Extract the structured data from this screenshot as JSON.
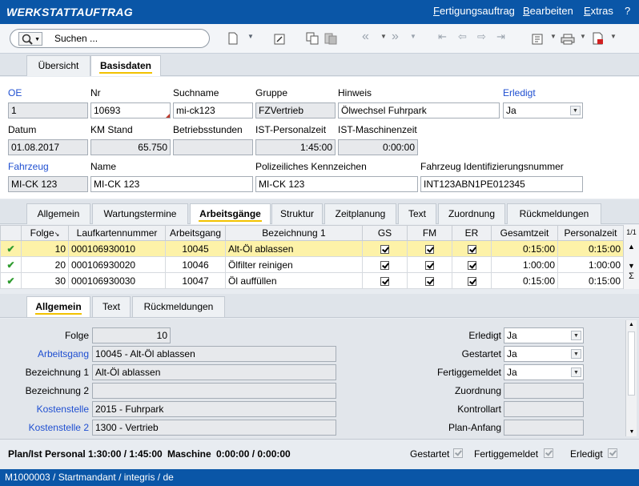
{
  "app": {
    "title": "WERKSTATTAUFTRAG"
  },
  "menu": [
    {
      "label": "Fertigungsauftrag"
    },
    {
      "label": "Bearbeiten"
    },
    {
      "label": "Extras"
    },
    {
      "label": "?"
    }
  ],
  "search": {
    "placeholder": "Suchen ..."
  },
  "main_tabs": [
    {
      "label": "Übersicht"
    },
    {
      "label": "Basisdaten"
    }
  ],
  "header_form": {
    "oe": {
      "label": "OE",
      "value": "1"
    },
    "nr": {
      "label": "Nr",
      "value": "10693"
    },
    "suchname": {
      "label": "Suchname",
      "value": "mi-ck123"
    },
    "gruppe": {
      "label": "Gruppe",
      "value": "FZVertrieb"
    },
    "hinweis": {
      "label": "Hinweis",
      "value": "Ölwechsel Fuhrpark"
    },
    "erledigt": {
      "label": "Erledigt",
      "value": "Ja"
    },
    "datum": {
      "label": "Datum",
      "value": "01.08.2017"
    },
    "km_stand": {
      "label": "KM Stand",
      "value": "65.750"
    },
    "betriebsstunden": {
      "label": "Betriebsstunden",
      "value": ""
    },
    "ist_personalzeit": {
      "label": "IST-Personalzeit",
      "value": "1:45:00"
    },
    "ist_maschinenzeit": {
      "label": "IST-Maschinenzeit",
      "value": "0:00:00"
    },
    "fahrzeug": {
      "label": "Fahrzeug",
      "value": "MI-CK 123"
    },
    "name": {
      "label": "Name",
      "value": "MI-CK 123"
    },
    "kennzeichen": {
      "label": "Polizeiliches Kennzeichen",
      "value": "MI-CK 123"
    },
    "fin": {
      "label": "Fahrzeug Identifizierungsnummer",
      "value": "INT123ABN1PE012345"
    }
  },
  "sub_tabs": [
    {
      "label": "Allgemein"
    },
    {
      "label": "Wartungstermine"
    },
    {
      "label": "Arbeitsgänge"
    },
    {
      "label": "Struktur"
    },
    {
      "label": "Zeitplanung"
    },
    {
      "label": "Text"
    },
    {
      "label": "Zuordnung"
    },
    {
      "label": "Rückmeldungen"
    }
  ],
  "grid": {
    "columns": [
      "Folge",
      "Laufkartennummer",
      "Arbeitsgang",
      "Bezeichnung 1",
      "GS",
      "FM",
      "ER",
      "Gesamtzeit",
      "Personalzeit"
    ],
    "page": "1/1",
    "rows": [
      {
        "folge": "10",
        "laufkarte": "000106930010",
        "arbeitsgang": "10045",
        "bezeichnung": "Alt-Öl ablassen",
        "gesamt": "0:15:00",
        "personal": "0:15:00"
      },
      {
        "folge": "20",
        "laufkarte": "000106930020",
        "arbeitsgang": "10046",
        "bezeichnung": "Ölfilter reinigen",
        "gesamt": "1:00:00",
        "personal": "1:00:00"
      },
      {
        "folge": "30",
        "laufkarte": "000106930030",
        "arbeitsgang": "10047",
        "bezeichnung": "Öl auffüllen",
        "gesamt": "0:15:00",
        "personal": "0:15:00"
      }
    ]
  },
  "detail_tabs": [
    {
      "label": "Allgemein"
    },
    {
      "label": "Text"
    },
    {
      "label": "Rückmeldungen"
    }
  ],
  "detail": {
    "folge": {
      "label": "Folge",
      "value": "10"
    },
    "arbeitsgang": {
      "label": "Arbeitsgang",
      "value": "10045 - Alt-Öl ablassen"
    },
    "bez1": {
      "label": "Bezeichnung 1",
      "value": "Alt-Öl ablassen"
    },
    "bez2": {
      "label": "Bezeichnung 2",
      "value": ""
    },
    "kostenstelle": {
      "label": "Kostenstelle",
      "value": "2015 - Fuhrpark"
    },
    "kostenstelle2": {
      "label": "Kostenstelle 2",
      "value": "1300 - Vertrieb"
    },
    "erledigt": {
      "label": "Erledigt",
      "value": "Ja"
    },
    "gestartet": {
      "label": "Gestartet",
      "value": "Ja"
    },
    "fertiggemeldet": {
      "label": "Fertiggemeldet",
      "value": "Ja"
    },
    "zuordnung": {
      "label": "Zuordnung",
      "value": ""
    },
    "kontrollart": {
      "label": "Kontrollart",
      "value": ""
    },
    "plan_anfang": {
      "label": "Plan-Anfang",
      "value": ""
    }
  },
  "summary": {
    "plan_ist_label": "Plan/Ist Personal",
    "plan_ist_value": "1:30:00 / 1:45:00",
    "maschine_label": "Maschine",
    "maschine_value": "0:00:00 / 0:00:00",
    "gestartet": "Gestartet",
    "fertiggemeldet": "Fertiggemeldet",
    "erledigt": "Erledigt"
  },
  "status": {
    "text": "M1000003 / Startmandant / integris / de"
  },
  "colors": {
    "brand_blue": "#0a56a7",
    "link_blue": "#1f4fd1",
    "selected_row": "#fdf2a8",
    "tab_underline": "#f2c200"
  }
}
